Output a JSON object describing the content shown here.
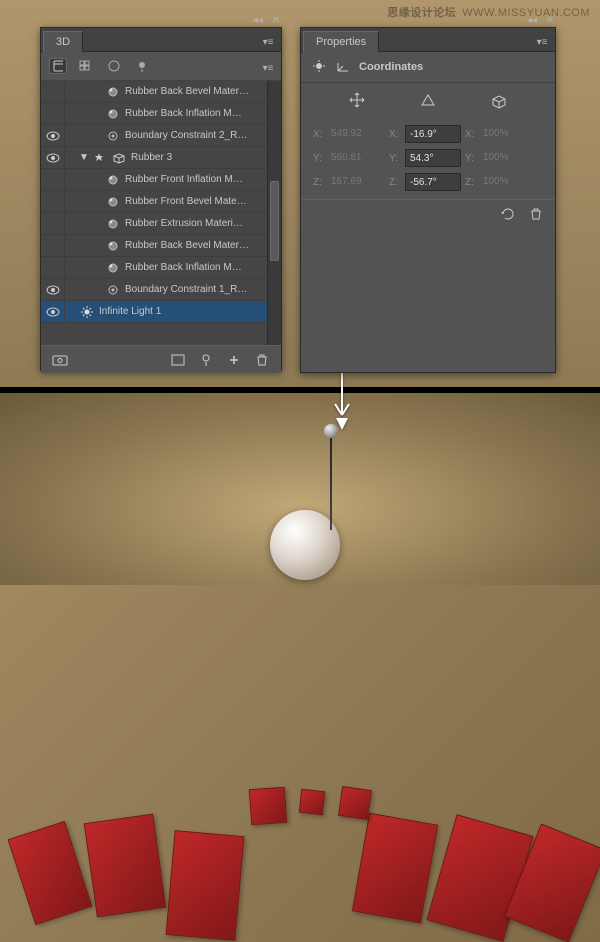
{
  "watermark": {
    "cn": "思缘设计论坛",
    "url": "WWW.MISSYUAN.COM"
  },
  "panel3d": {
    "title": "3D",
    "layers": [
      {
        "indent": 2,
        "icon": "material",
        "label": "Rubber Back Bevel Mater…",
        "eye": false
      },
      {
        "indent": 2,
        "icon": "material",
        "label": "Rubber Back Inflation M…",
        "eye": false
      },
      {
        "indent": 2,
        "icon": "constraint",
        "label": "Boundary Constraint 2_R…",
        "eye": true
      },
      {
        "indent": 1,
        "icon": "mesh",
        "label": "Rubber 3",
        "eye": true,
        "disclosure": "down"
      },
      {
        "indent": 2,
        "icon": "material",
        "label": "Rubber Front Inflation M…",
        "eye": false
      },
      {
        "indent": 2,
        "icon": "material",
        "label": "Rubber Front Bevel Mate…",
        "eye": false
      },
      {
        "indent": 2,
        "icon": "material",
        "label": "Rubber Extrusion Materi…",
        "eye": false
      },
      {
        "indent": 2,
        "icon": "material",
        "label": "Rubber Back Bevel Mater…",
        "eye": false
      },
      {
        "indent": 2,
        "icon": "material",
        "label": "Rubber Back Inflation M…",
        "eye": false
      },
      {
        "indent": 2,
        "icon": "constraint",
        "label": "Boundary Constraint 1_R…",
        "eye": true
      },
      {
        "indent": 1,
        "icon": "light",
        "label": "Infinite Light 1",
        "eye": true,
        "selected": true
      }
    ]
  },
  "panelProps": {
    "title": "Properties",
    "section": "Coordinates",
    "rows": [
      {
        "axis": "X:",
        "pos": "549.92",
        "rot": "-16.9°",
        "scale": "100%"
      },
      {
        "axis": "Y:",
        "pos": "560.81",
        "rot": "54.3°",
        "scale": "100%"
      },
      {
        "axis": "Z:",
        "pos": "167.69",
        "rot": "-56.7°",
        "scale": "100%"
      }
    ]
  }
}
